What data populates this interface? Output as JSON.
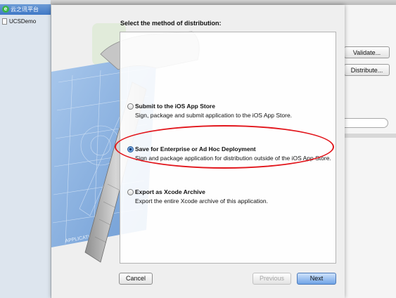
{
  "sidebar": {
    "header": {
      "icon": "e",
      "label": "云之讯平台"
    },
    "items": [
      {
        "label": "UCSDemo"
      }
    ]
  },
  "organizer": {
    "validate_label": "Validate...",
    "distribute_label": "Distribute..."
  },
  "sheet": {
    "title": "Select the method of distribution:",
    "options": [
      {
        "title": "Submit to the iOS App Store",
        "description": "Sign, package and submit application to the iOS App Store.",
        "selected": false
      },
      {
        "title": "Save for Enterprise or Ad Hoc Deployment",
        "description": "Sign and package application for distribution outside of the iOS App Store.",
        "selected": true
      },
      {
        "title": "Export as Xcode Archive",
        "description": "Export the entire Xcode archive of this application.",
        "selected": false
      }
    ],
    "buttons": {
      "cancel": "Cancel",
      "previous": "Previous",
      "next": "Next"
    }
  },
  "art": {
    "icon": "xcode-hammer-blueprint-icon",
    "blueprint_text": "APPLICATION"
  },
  "colors": {
    "highlight_circle": "#e2161c",
    "default_button": "#6fa3e6",
    "sidebar_header": "#3f78c6"
  }
}
